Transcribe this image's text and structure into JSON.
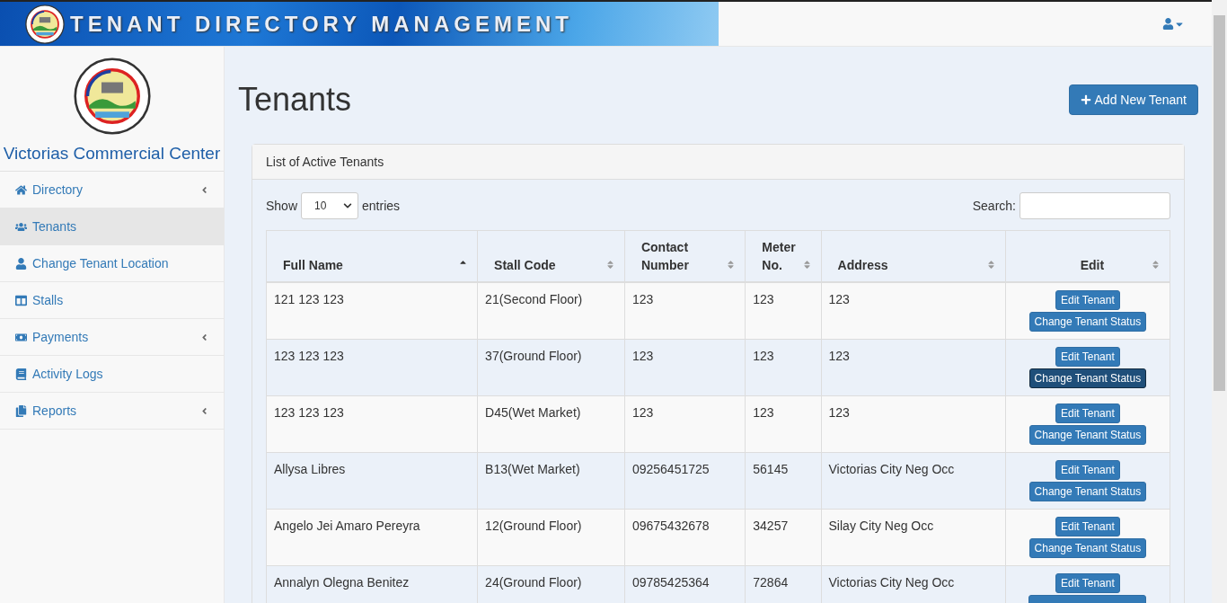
{
  "header": {
    "banner_title": "TENANT DIRECTORY MANAGEMENT"
  },
  "sidebar": {
    "brand": "Victorias Commercial Center",
    "items": [
      {
        "label": "Directory",
        "selected": false,
        "expandable": true
      },
      {
        "label": "Tenants",
        "selected": true,
        "expandable": false
      },
      {
        "label": "Change Tenant Location",
        "selected": false,
        "expandable": false
      },
      {
        "label": "Stalls",
        "selected": false,
        "expandable": false
      },
      {
        "label": "Payments",
        "selected": false,
        "expandable": true
      },
      {
        "label": "Activity Logs",
        "selected": false,
        "expandable": false
      },
      {
        "label": "Reports",
        "selected": false,
        "expandable": true
      }
    ]
  },
  "page": {
    "title": "Tenants",
    "add_button": "Add New Tenant"
  },
  "panel": {
    "heading": "List of Active Tenants",
    "show_label": "Show",
    "page_size": "10",
    "entries_label": "entries",
    "search_label": "Search:",
    "columns": [
      {
        "lines": [
          "Full Name"
        ],
        "sorted": true
      },
      {
        "lines": [
          "Stall Code"
        ],
        "sorted": false
      },
      {
        "lines": [
          "Contact",
          "Number"
        ],
        "sorted": false
      },
      {
        "lines": [
          "Meter",
          "No."
        ],
        "sorted": false
      },
      {
        "lines": [
          "Address"
        ],
        "sorted": false
      },
      {
        "lines": [
          "Edit"
        ],
        "sorted": false
      }
    ],
    "rows": [
      {
        "cells": [
          "121 123 123",
          "21(Second Floor)",
          "123",
          "123",
          "123"
        ],
        "edit_button": "Edit Tenant",
        "status_button": "Change Tenant Status",
        "status_focused": false
      },
      {
        "cells": [
          "123 123 123",
          "37(Ground Floor)",
          "123",
          "123",
          "123"
        ],
        "edit_button": "Edit Tenant",
        "status_button": "Change Tenant Status",
        "status_focused": true
      },
      {
        "cells": [
          "123 123 123",
          "D45(Wet Market)",
          "123",
          "123",
          "123"
        ],
        "edit_button": "Edit Tenant",
        "status_button": "Change Tenant Status",
        "status_focused": false
      },
      {
        "cells": [
          "Allysa Libres",
          "B13(Wet Market)",
          "09256451725",
          "56145",
          "Victorias City Neg Occ"
        ],
        "edit_button": "Edit Tenant",
        "status_button": "Change Tenant Status",
        "status_focused": false
      },
      {
        "cells": [
          "Angelo Jei Amaro Pereyra",
          "12(Ground Floor)",
          "09675432678",
          "34257",
          "Silay City Neg Occ"
        ],
        "edit_button": "Edit Tenant",
        "status_button": "Change Tenant Status",
        "status_focused": false
      },
      {
        "cells": [
          "Annalyn Olegna Benitez",
          "24(Ground Floor)",
          "09785425364",
          "72864",
          "Victorias City Neg Occ"
        ],
        "edit_button": "Edit Tenant",
        "status_focused": false
      }
    ]
  }
}
